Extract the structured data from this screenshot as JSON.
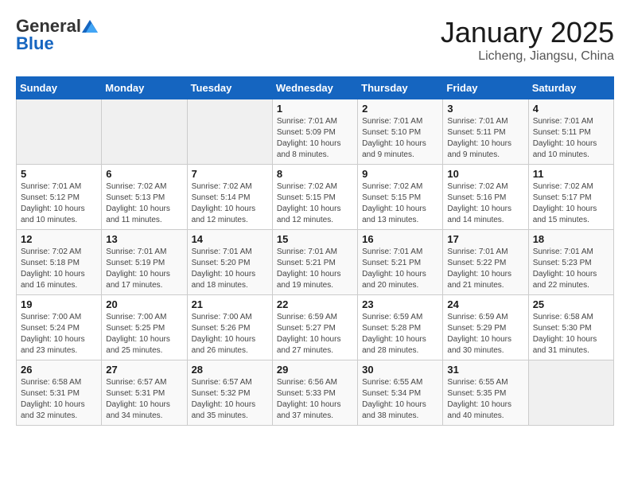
{
  "header": {
    "logo_general": "General",
    "logo_blue": "Blue",
    "month_title": "January 2025",
    "location": "Licheng, Jiangsu, China"
  },
  "weekdays": [
    "Sunday",
    "Monday",
    "Tuesday",
    "Wednesday",
    "Thursday",
    "Friday",
    "Saturday"
  ],
  "weeks": [
    [
      {
        "day": "",
        "info": ""
      },
      {
        "day": "",
        "info": ""
      },
      {
        "day": "",
        "info": ""
      },
      {
        "day": "1",
        "info": "Sunrise: 7:01 AM\nSunset: 5:09 PM\nDaylight: 10 hours\nand 8 minutes."
      },
      {
        "day": "2",
        "info": "Sunrise: 7:01 AM\nSunset: 5:10 PM\nDaylight: 10 hours\nand 9 minutes."
      },
      {
        "day": "3",
        "info": "Sunrise: 7:01 AM\nSunset: 5:11 PM\nDaylight: 10 hours\nand 9 minutes."
      },
      {
        "day": "4",
        "info": "Sunrise: 7:01 AM\nSunset: 5:11 PM\nDaylight: 10 hours\nand 10 minutes."
      }
    ],
    [
      {
        "day": "5",
        "info": "Sunrise: 7:01 AM\nSunset: 5:12 PM\nDaylight: 10 hours\nand 10 minutes."
      },
      {
        "day": "6",
        "info": "Sunrise: 7:02 AM\nSunset: 5:13 PM\nDaylight: 10 hours\nand 11 minutes."
      },
      {
        "day": "7",
        "info": "Sunrise: 7:02 AM\nSunset: 5:14 PM\nDaylight: 10 hours\nand 12 minutes."
      },
      {
        "day": "8",
        "info": "Sunrise: 7:02 AM\nSunset: 5:15 PM\nDaylight: 10 hours\nand 12 minutes."
      },
      {
        "day": "9",
        "info": "Sunrise: 7:02 AM\nSunset: 5:15 PM\nDaylight: 10 hours\nand 13 minutes."
      },
      {
        "day": "10",
        "info": "Sunrise: 7:02 AM\nSunset: 5:16 PM\nDaylight: 10 hours\nand 14 minutes."
      },
      {
        "day": "11",
        "info": "Sunrise: 7:02 AM\nSunset: 5:17 PM\nDaylight: 10 hours\nand 15 minutes."
      }
    ],
    [
      {
        "day": "12",
        "info": "Sunrise: 7:02 AM\nSunset: 5:18 PM\nDaylight: 10 hours\nand 16 minutes."
      },
      {
        "day": "13",
        "info": "Sunrise: 7:01 AM\nSunset: 5:19 PM\nDaylight: 10 hours\nand 17 minutes."
      },
      {
        "day": "14",
        "info": "Sunrise: 7:01 AM\nSunset: 5:20 PM\nDaylight: 10 hours\nand 18 minutes."
      },
      {
        "day": "15",
        "info": "Sunrise: 7:01 AM\nSunset: 5:21 PM\nDaylight: 10 hours\nand 19 minutes."
      },
      {
        "day": "16",
        "info": "Sunrise: 7:01 AM\nSunset: 5:21 PM\nDaylight: 10 hours\nand 20 minutes."
      },
      {
        "day": "17",
        "info": "Sunrise: 7:01 AM\nSunset: 5:22 PM\nDaylight: 10 hours\nand 21 minutes."
      },
      {
        "day": "18",
        "info": "Sunrise: 7:01 AM\nSunset: 5:23 PM\nDaylight: 10 hours\nand 22 minutes."
      }
    ],
    [
      {
        "day": "19",
        "info": "Sunrise: 7:00 AM\nSunset: 5:24 PM\nDaylight: 10 hours\nand 23 minutes."
      },
      {
        "day": "20",
        "info": "Sunrise: 7:00 AM\nSunset: 5:25 PM\nDaylight: 10 hours\nand 25 minutes."
      },
      {
        "day": "21",
        "info": "Sunrise: 7:00 AM\nSunset: 5:26 PM\nDaylight: 10 hours\nand 26 minutes."
      },
      {
        "day": "22",
        "info": "Sunrise: 6:59 AM\nSunset: 5:27 PM\nDaylight: 10 hours\nand 27 minutes."
      },
      {
        "day": "23",
        "info": "Sunrise: 6:59 AM\nSunset: 5:28 PM\nDaylight: 10 hours\nand 28 minutes."
      },
      {
        "day": "24",
        "info": "Sunrise: 6:59 AM\nSunset: 5:29 PM\nDaylight: 10 hours\nand 30 minutes."
      },
      {
        "day": "25",
        "info": "Sunrise: 6:58 AM\nSunset: 5:30 PM\nDaylight: 10 hours\nand 31 minutes."
      }
    ],
    [
      {
        "day": "26",
        "info": "Sunrise: 6:58 AM\nSunset: 5:31 PM\nDaylight: 10 hours\nand 32 minutes."
      },
      {
        "day": "27",
        "info": "Sunrise: 6:57 AM\nSunset: 5:31 PM\nDaylight: 10 hours\nand 34 minutes."
      },
      {
        "day": "28",
        "info": "Sunrise: 6:57 AM\nSunset: 5:32 PM\nDaylight: 10 hours\nand 35 minutes."
      },
      {
        "day": "29",
        "info": "Sunrise: 6:56 AM\nSunset: 5:33 PM\nDaylight: 10 hours\nand 37 minutes."
      },
      {
        "day": "30",
        "info": "Sunrise: 6:55 AM\nSunset: 5:34 PM\nDaylight: 10 hours\nand 38 minutes."
      },
      {
        "day": "31",
        "info": "Sunrise: 6:55 AM\nSunset: 5:35 PM\nDaylight: 10 hours\nand 40 minutes."
      },
      {
        "day": "",
        "info": ""
      }
    ]
  ]
}
